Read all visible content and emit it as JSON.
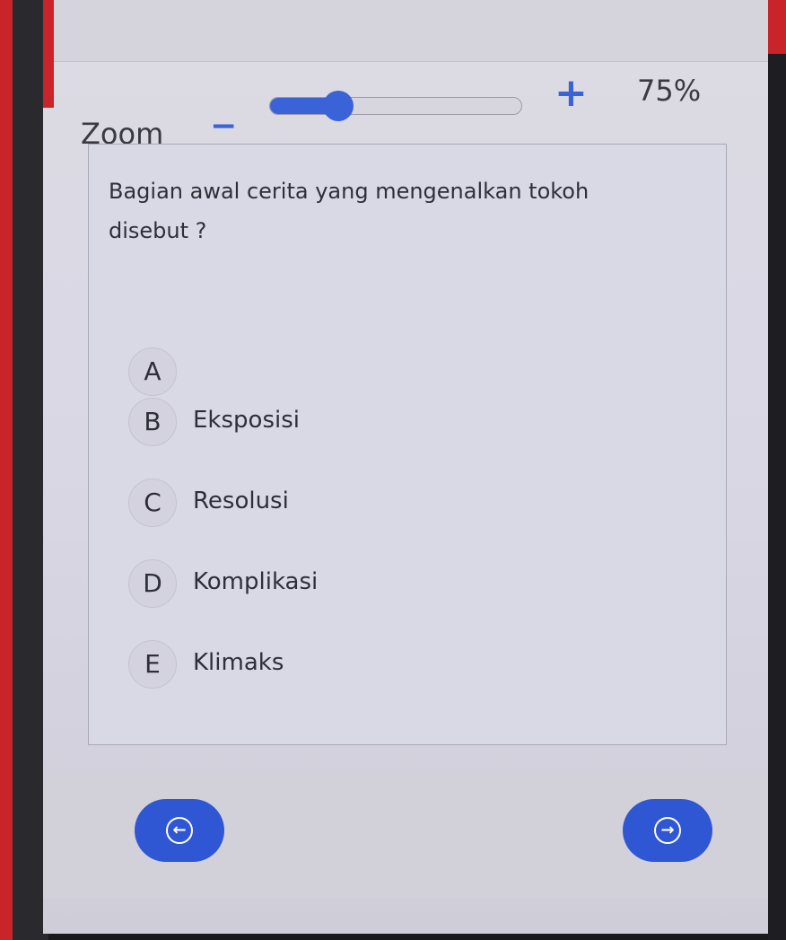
{
  "zoom": {
    "label": "Zoom",
    "minus_symbol": "−",
    "plus_symbol": "+",
    "value_text": "75%",
    "slider_fraction": 0.2
  },
  "question": {
    "text": "Bagian awal cerita yang mengenalkan tokoh disebut ?"
  },
  "options": [
    {
      "letter": "A",
      "text": ""
    },
    {
      "letter": "B",
      "text": "Eksposisi"
    },
    {
      "letter": "C",
      "text": "Resolusi"
    },
    {
      "letter": "D",
      "text": "Komplikasi"
    },
    {
      "letter": "E",
      "text": "Klimaks"
    }
  ],
  "navigation": {
    "prev_icon": "arrow-left-circle-icon",
    "next_icon": "arrow-right-circle-icon",
    "prev_glyph": "←",
    "next_glyph": "→"
  },
  "colors": {
    "accent": "#2f56d3",
    "frame_red": "#c8242a"
  }
}
